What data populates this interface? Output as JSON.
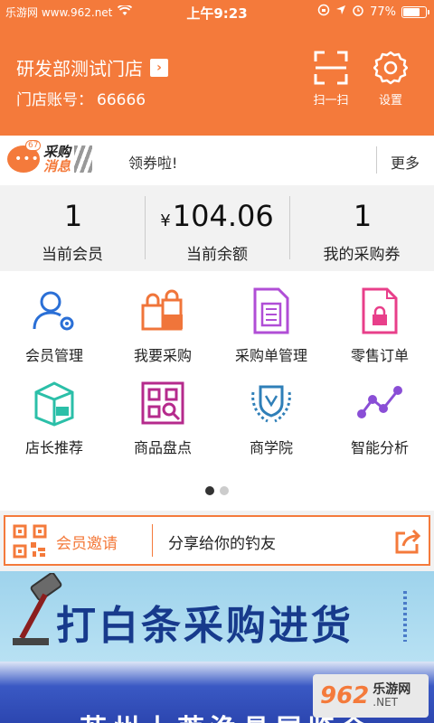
{
  "statusbar": {
    "site": "乐游网 www.962.net",
    "time": "上午9:23",
    "battery": "77%",
    "battery_level": 0.77
  },
  "header": {
    "store_name": "研发部测试门店",
    "account_label": "门店账号：",
    "account_value": "66666",
    "scan_label": "扫一扫",
    "settings_label": "设置"
  },
  "news": {
    "logo_line1": "采购",
    "logo_line2": "消息",
    "badge": "67",
    "text": "领券啦!",
    "more": "更多"
  },
  "stats": [
    {
      "value": "1",
      "currency": "",
      "label": "当前会员"
    },
    {
      "value": "104.06",
      "currency": "¥",
      "label": "当前余额"
    },
    {
      "value": "1",
      "currency": "",
      "label": "我的采购券"
    }
  ],
  "grid": [
    {
      "label": "会员管理",
      "icon": "member-management-icon",
      "color": "#2a6fd6"
    },
    {
      "label": "我要采购",
      "icon": "purchase-icon",
      "color": "#f0753a"
    },
    {
      "label": "采购单管理",
      "icon": "purchase-order-icon",
      "color": "#b04ed6"
    },
    {
      "label": "零售订单",
      "icon": "retail-order-icon",
      "color": "#e83f8a"
    },
    {
      "label": "店长推荐",
      "icon": "recommend-box-icon",
      "color": "#2bbfa8"
    },
    {
      "label": "商品盘点",
      "icon": "inventory-icon",
      "color": "#b52a8c"
    },
    {
      "label": "商学院",
      "icon": "academy-laurel-icon",
      "color": "#2f7fb8"
    },
    {
      "label": "智能分析",
      "icon": "analysis-icon",
      "color": "#8a4ed6"
    }
  ],
  "pager": {
    "pages": 2,
    "active": 0
  },
  "invite": {
    "title": "会员邀请",
    "text": "分享给你的钓友"
  },
  "banner": {
    "text": "打白条采购进货"
  },
  "banner2": {
    "text": "苏州上莘渔具展览会"
  },
  "watermark": {
    "number": "962",
    "line1": "乐游网",
    "line2": ".NET"
  },
  "colors": {
    "accent": "#f47a3b"
  }
}
